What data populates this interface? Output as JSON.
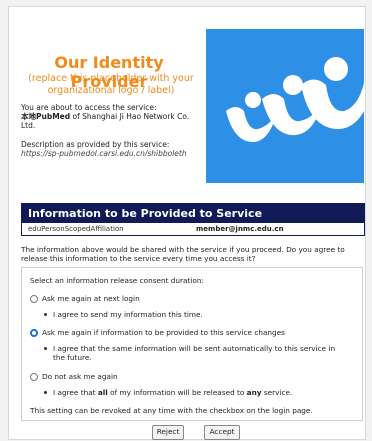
{
  "org": {
    "title": "Our Identity Provider",
    "subtitle": "(replace this placeholder with your organizational logo / label)"
  },
  "access": {
    "intro": "You are about to access the service:",
    "service_name": "本地PubMed",
    "service_of": " of Shanghai Ji Hao Network Co. Ltd.",
    "desc_label": "Description as provided by this service:",
    "desc_url": "https://sp-pubmedol.carsi.edu.cn/shibboleth"
  },
  "logo": {
    "background": "#2e8fe6",
    "icon": "people-logo-icon"
  },
  "info": {
    "title": "Information to be Provided to Service",
    "rows": [
      {
        "attribute": "eduPersonScopedAffiliation",
        "value": "member@jnmc.edu.cn"
      }
    ]
  },
  "notice": "The information above would be shared with the service if you proceed. Do you agree to release this information to the service every time you access it?",
  "consent": {
    "heading": "Select an information release consent duration:",
    "options": [
      {
        "label": "Ask me again at next login",
        "detail": "I agree to send my information this time.",
        "selected": false
      },
      {
        "label": "Ask me again if information to be provided to this service changes",
        "detail": "I agree that the same information will be sent automatically to this service in the future.",
        "selected": true
      },
      {
        "label": "Do not ask me again",
        "detail_parts": [
          "I agree that ",
          "all",
          " of my information will be released to ",
          "any",
          " service."
        ],
        "selected": false
      }
    ],
    "revoke": "This setting can be revoked at any time with the checkbox on the login page."
  },
  "buttons": {
    "reject": "Reject",
    "accept": "Accept"
  }
}
